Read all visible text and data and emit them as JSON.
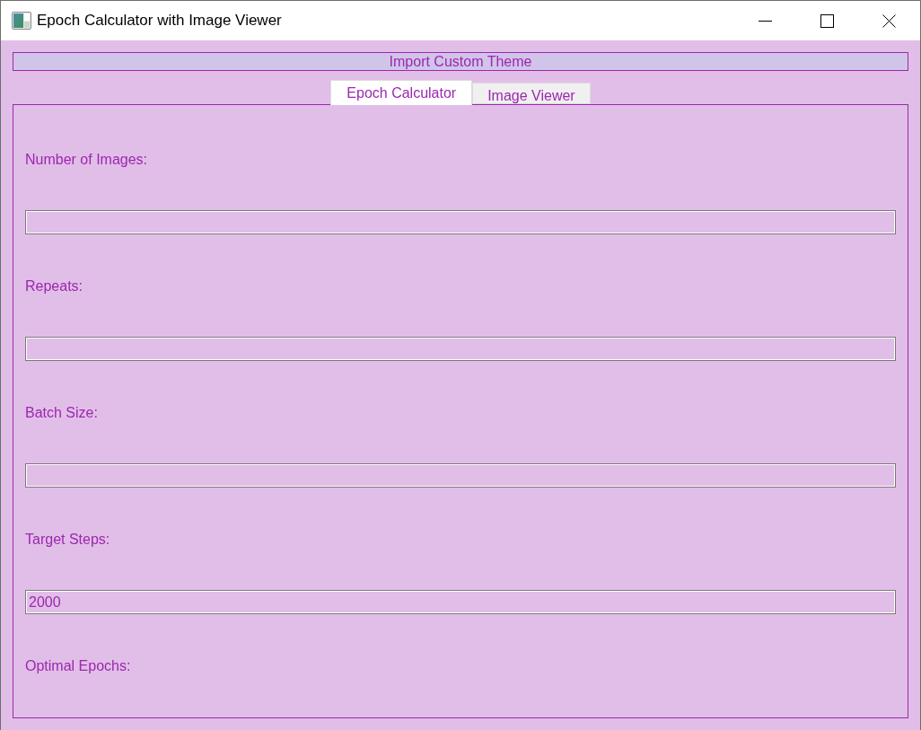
{
  "window": {
    "title": "Epoch Calculator with Image Viewer"
  },
  "import_button": {
    "label": "Import Custom Theme"
  },
  "tabs": [
    {
      "label": "Epoch Calculator",
      "selected": true
    },
    {
      "label": "Image Viewer",
      "selected": false
    }
  ],
  "fields": [
    {
      "label": "Number of Images:"
    },
    {
      "label": "Repeats:"
    },
    {
      "label": "Batch Size:"
    },
    {
      "label": "Target Steps:",
      "value": "2000"
    }
  ],
  "result": {
    "label": "Optimal Epochs:"
  }
}
